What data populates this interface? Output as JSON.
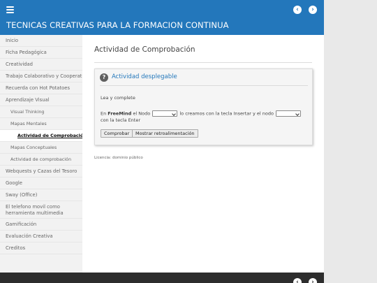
{
  "header": {
    "title": "TECNICAS CREATIVAS PARA LA FORMACION CONTINUA",
    "prev_icon": "‹",
    "next_icon": "›"
  },
  "sidebar": {
    "items": [
      {
        "label": "Inicio",
        "level": 1
      },
      {
        "label": "Ficha Pedagógica",
        "level": 1
      },
      {
        "label": "Creatividad",
        "level": 1
      },
      {
        "label": "Trabajo Colaborativo y Cooperativo",
        "level": 1
      },
      {
        "label": "Recuerda con Hot Potatoes",
        "level": 1
      },
      {
        "label": "Aprendizaje Visual",
        "level": 1
      },
      {
        "label": "Visual Thinking",
        "level": 2
      },
      {
        "label": "Mapas Mentales",
        "level": 2
      },
      {
        "label": "Actividad de Comprobación",
        "level": 3,
        "active": true
      },
      {
        "label": "Mapas Conceptuales",
        "level": 2
      },
      {
        "label": "Actividad de comprobación",
        "level": 2
      },
      {
        "label": "Webquests y Cazas del Tesoro",
        "level": 1
      },
      {
        "label": "Google",
        "level": 1
      },
      {
        "label": "Sway (Office)",
        "level": 1
      },
      {
        "label": "El telefono movil como herramienta multimedia",
        "level": 1
      },
      {
        "label": "Gamificación",
        "level": 1
      },
      {
        "label": "Evaluación Creativa",
        "level": 1
      },
      {
        "label": "Creditos",
        "level": 1
      }
    ]
  },
  "main": {
    "page_title": "Actividad de Comprobación",
    "idevice": {
      "icon": "?",
      "title": "Actividad desplegable",
      "instructions": "Lea y complete",
      "text_before": "En ",
      "text_bold": "FreeMind",
      "text_part1": " el Nodo ",
      "text_part2": " lo creamos con la tecla Insertar  y el nodo ",
      "text_part3": " con la tecla Enter",
      "select1_value": "",
      "select2_value": "",
      "check_label": "Comprobar",
      "feedback_label": "Mostrar retroalimentación"
    },
    "license": "Licencia: dominio público"
  },
  "footer": {
    "prev_icon": "‹",
    "next_icon": "›"
  }
}
